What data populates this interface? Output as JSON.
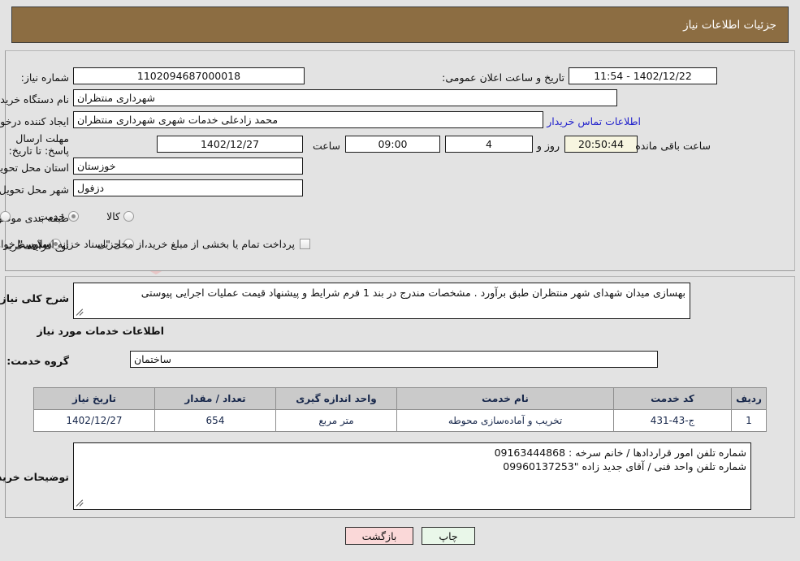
{
  "header": {
    "title": "جزئیات اطلاعات نیاز"
  },
  "form": {
    "need_number_label": "شماره نیاز:",
    "need_number_value": "1102094687000018",
    "announce_label": "تاریخ و ساعت اعلان عمومی:",
    "announce_value": "1402/12/22 - 11:54",
    "buyer_org_label": "نام دستگاه خریدار:",
    "buyer_org_value": "شهرداری منتظران",
    "creator_label": "ایجاد کننده درخواست:",
    "creator_value": "محمد زادعلی خدمات شهری  شهرداری منتظران",
    "contact_link": "اطلاعات تماس خریدار",
    "deadline_label": "مهلت ارسال پاسخ: تا تاریخ:",
    "deadline_date": "1402/12/27",
    "hour_label": "ساعت",
    "deadline_time": "09:00",
    "days_value": "4",
    "days_label": "روز و",
    "countdown_value": "20:50:44",
    "remaining_label": "ساعت باقی مانده",
    "province_label": "استان محل تحویل:",
    "province_value": "خوزستان",
    "city_label": "شهر محل تحویل:",
    "city_value": "دزفول",
    "category_label": "طبقه بندی موضوعی:",
    "category_options": [
      {
        "label": "کالا",
        "selected": false
      },
      {
        "label": "خدمت",
        "selected": true
      },
      {
        "label": "کالا/خدمت",
        "selected": false
      }
    ],
    "process_label": "نوع فرآیند خرید :",
    "process_options": [
      {
        "label": "جزیی",
        "selected": false
      },
      {
        "label": "متوسط",
        "selected": true
      }
    ],
    "treasury_checkbox_label": "پرداخت تمام یا بخشی از مبلغ خرید،از محل \"اسناد خزانه اسلامی\" خواهد بود.",
    "treasury_checked": false
  },
  "details": {
    "summary_label": "شرح کلی نیاز:",
    "summary_value": "بهسازی میدان شهدای شهر منتظران طبق برآورد . مشخصات مندرج در بند 1 فرم شرایط و پیشنهاد قیمت عملیات اجرایی پیوستی",
    "services_heading": "اطلاعات خدمات مورد نیاز",
    "service_group_label": "گروه خدمت:",
    "service_group_value": "ساختمان",
    "buyer_notes_label": "توضیحات خریدار:",
    "buyer_notes_value": "شماره تلفن امور قراردادها / خانم سرخه : 09163444868\nشماره تلفن واحد فنی / آقای جدید زاده \"09960137253"
  },
  "table": {
    "columns": [
      "ردیف",
      "کد خدمت",
      "نام خدمت",
      "واحد اندازه گیری",
      "تعداد / مقدار",
      "تاریخ نیاز"
    ],
    "rows": [
      {
        "row": "1",
        "code": "ج-43-431",
        "name": "تخریب و آماده‌سازی محوطه",
        "unit": "متر مربع",
        "qty": "654",
        "date": "1402/12/27"
      }
    ]
  },
  "buttons": {
    "print": "چاپ",
    "back": "بازگشت"
  }
}
